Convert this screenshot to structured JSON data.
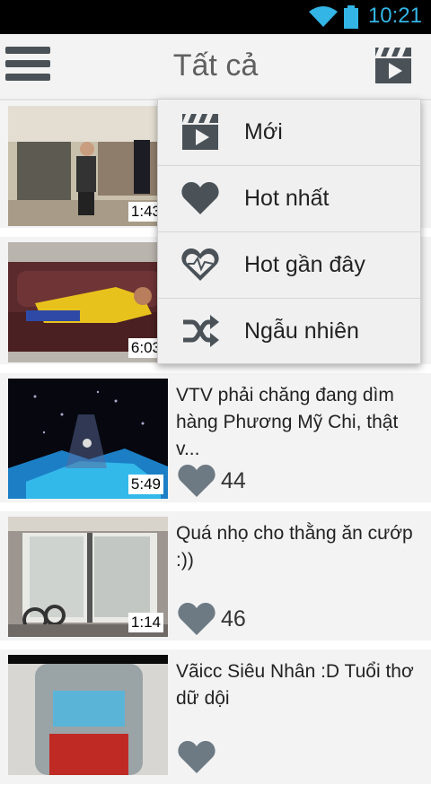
{
  "status_bar": {
    "time": "10:21"
  },
  "action_bar": {
    "title": "Tất cả"
  },
  "colors": {
    "accent": "#33b5e5",
    "icon": "#4a5258",
    "heart": "#6d7a84"
  },
  "videos": [
    {
      "duration": "1:43",
      "title": "",
      "likes": ""
    },
    {
      "duration": "6:03",
      "title": "",
      "likes": ""
    },
    {
      "duration": "5:49",
      "title": "VTV phải chăng đang dìm hàng Phương Mỹ Chi, thật v...",
      "likes": "44"
    },
    {
      "duration": "1:14",
      "title": "Quá nhọ cho thằng ăn cướp  :))",
      "likes": "46"
    },
    {
      "duration": "",
      "title": "Vãicc Siêu Nhân :D Tuổi thơ dữ dội",
      "likes": ""
    }
  ],
  "menu": {
    "items": [
      {
        "label": "Mới",
        "icon": "clapperboard-icon"
      },
      {
        "label": "Hot nhất",
        "icon": "heart-icon"
      },
      {
        "label": "Hot gần đây",
        "icon": "heart-outline-icon"
      },
      {
        "label": "Ngẫu nhiên",
        "icon": "shuffle-icon"
      }
    ]
  }
}
